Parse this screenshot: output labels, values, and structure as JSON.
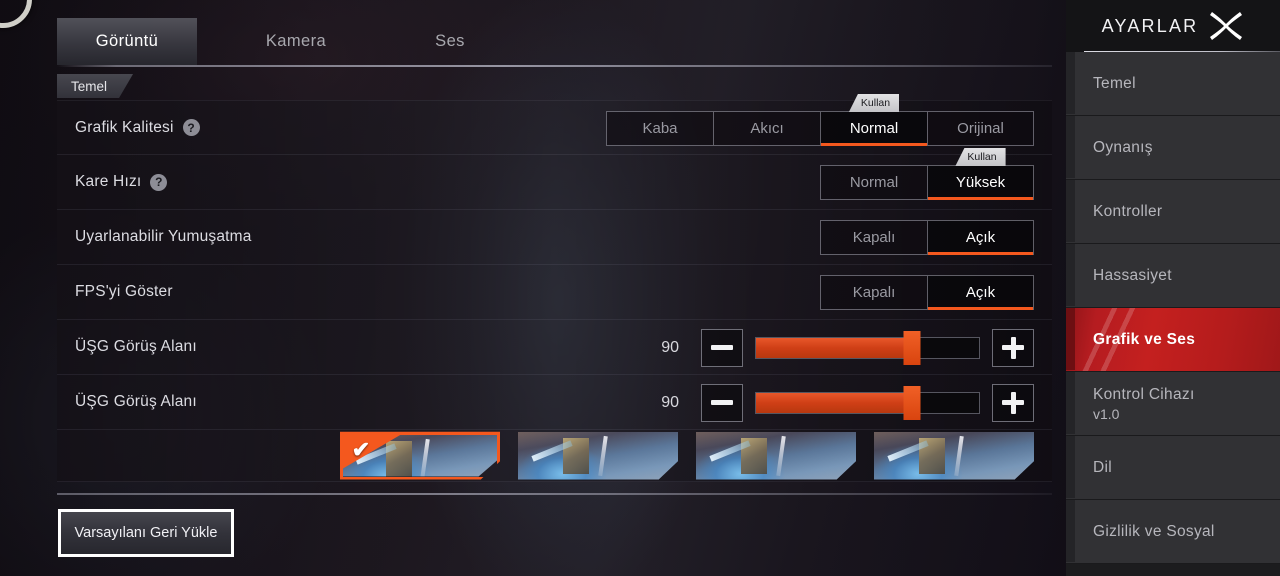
{
  "sidebar": {
    "title": "AYARLAR",
    "close_icon": "close-x-icon",
    "items": [
      {
        "label": "Temel"
      },
      {
        "label": "Oynanış"
      },
      {
        "label": "Kontroller"
      },
      {
        "label": "Hassasiyet"
      },
      {
        "label": "Grafik ve Ses",
        "active": true
      },
      {
        "label": "Kontrol Cihazı",
        "sub": "v1.0"
      },
      {
        "label": "Dil"
      },
      {
        "label": "Gizlilik ve Sosyal"
      }
    ]
  },
  "tabs": [
    {
      "label": "Görüntü",
      "active": true
    },
    {
      "label": "Kamera",
      "active": false
    },
    {
      "label": "Ses",
      "active": false
    }
  ],
  "subtab": {
    "label": "Temel"
  },
  "badge": {
    "kullan": "Kullan"
  },
  "rows": [
    {
      "label": "Grafik Kalitesi",
      "help": "?",
      "type": "segmented",
      "options": [
        "Kaba",
        "Akıcı",
        "Normal",
        "Orijinal"
      ],
      "selected": "Normal",
      "badge": "Kullan"
    },
    {
      "label": "Kare Hızı",
      "help": "?",
      "type": "segmented",
      "options": [
        "Normal",
        "Yüksek"
      ],
      "selected": "Yüksek",
      "badge": "Kullan"
    },
    {
      "label": "Uyarlanabilir Yumuşatma",
      "type": "segmented",
      "options": [
        "Kapalı",
        "Açık"
      ],
      "selected": "Açık"
    },
    {
      "label": "FPS'yi Göster",
      "type": "segmented",
      "options": [
        "Kapalı",
        "Açık"
      ],
      "selected": "Açık"
    },
    {
      "label": "ÜŞG Görüş Alanı",
      "type": "slider",
      "value": "90",
      "percent": 70,
      "minus": "−",
      "plus": "+"
    },
    {
      "label": "ÜŞG Görüş Alanı",
      "type": "slider",
      "value": "90",
      "percent": 70,
      "minus": "−",
      "plus": "+"
    }
  ],
  "gallery": {
    "thumbs": [
      {
        "selected": true,
        "check": "✔"
      },
      {
        "selected": false
      },
      {
        "selected": false
      },
      {
        "selected": false
      }
    ]
  },
  "footer": {
    "restore_label": "Varsayılanı Geri Yükle"
  },
  "colors": {
    "accent_orange": "#f4581e",
    "active_red": "#c4201f",
    "panel_dark": "#1c1c1e",
    "side_item": "#313134"
  }
}
